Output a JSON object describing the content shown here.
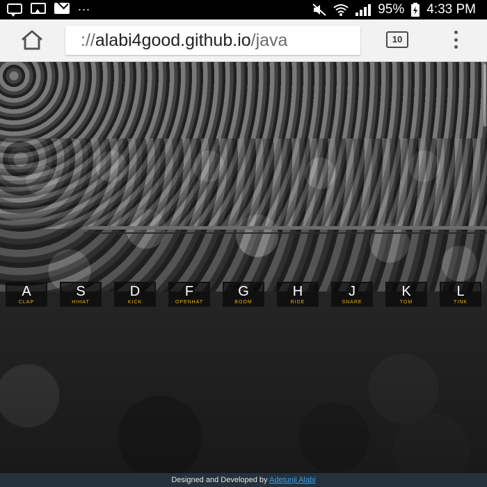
{
  "status_bar": {
    "icons_left": [
      "chat-icon",
      "photo-icon",
      "mail-icon"
    ],
    "overflow": "...",
    "battery_percent": "95%",
    "time": "4:33 PM"
  },
  "browser": {
    "url_scheme": "://",
    "url_host": "alabi4good.github.io",
    "url_path": "/java",
    "tab_count": "10"
  },
  "drum_keys": [
    {
      "letter": "A",
      "sound": "CLAP"
    },
    {
      "letter": "S",
      "sound": "HIHAT"
    },
    {
      "letter": "D",
      "sound": "KICK"
    },
    {
      "letter": "F",
      "sound": "OPENHAT"
    },
    {
      "letter": "G",
      "sound": "BOOM"
    },
    {
      "letter": "H",
      "sound": "RIDE"
    },
    {
      "letter": "J",
      "sound": "SNARE"
    },
    {
      "letter": "K",
      "sound": "TOM"
    },
    {
      "letter": "L",
      "sound": "TINK"
    }
  ],
  "footer": {
    "text": "Designed and Developed by",
    "author_link": "Adetunji Alabi"
  },
  "colors": {
    "key_sound": "#f0b400",
    "footer_bg": "#25323d",
    "footer_link": "#3aa0e8"
  }
}
